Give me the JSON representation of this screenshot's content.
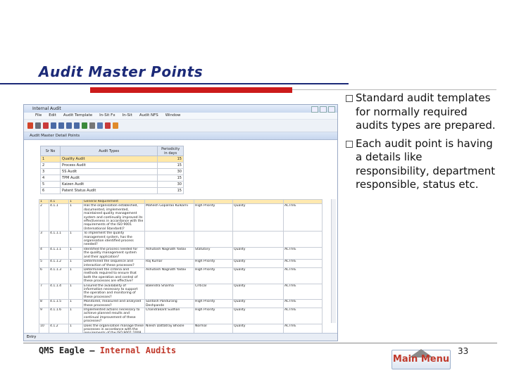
{
  "slide": {
    "title": "Audit Master Points",
    "bullets": [
      "Standard audit templates for normally required audits types are prepared.",
      "Each audit point is having a details like responsibility, department responsible, status etc."
    ],
    "footer_left_prefix": "QMS Eagle – ",
    "footer_left_accent": "Internal Audits",
    "main_menu_label": "Main Menu",
    "page_number": "33",
    "colors": {
      "title": "#1c2a78",
      "accent_red": "#cc1b1b",
      "footer_accent": "#c0392b"
    }
  },
  "app": {
    "window_title": "Internal Audit",
    "menu": [
      "File",
      "Edit",
      "Audit Template",
      "In-Sit Fx",
      "In-Sit",
      "Audit NFS",
      "Window"
    ],
    "subwindow_title": "Audit Master Detail Points",
    "types_headers": [
      "Sr No",
      "Audit Types",
      "Periodicity in days"
    ],
    "types_rows": [
      [
        "1",
        "Quality Audit",
        "15"
      ],
      [
        "2",
        "Process Audit",
        "15"
      ],
      [
        "3",
        "5S Audit",
        "30"
      ],
      [
        "4",
        "TPM Audit",
        "15"
      ],
      [
        "5",
        "Kaizen Audit",
        "30"
      ],
      [
        "6",
        "Patent Status Audit",
        "15"
      ]
    ],
    "points_rows": [
      [
        "1",
        "4.1",
        "1",
        "General Requirement",
        "",
        "",
        "",
        ""
      ],
      [
        "2",
        "4.1.1",
        "1",
        "Has the organisation established, documented, implemented, maintained quality management system and continually improved its effectiveness in accordance with the requirements of the ISO 9001 (International Standard)?",
        "Mahesh Gopalrao Kulkarni",
        "High Priority",
        "Quality",
        "ACTIVE"
      ],
      [
        "3",
        "4.1.1.1",
        "1",
        "To implement the quality management system, has the organisation identified process needed?",
        "",
        "",
        "",
        ""
      ],
      [
        "4",
        "4.1.1.1",
        "1",
        "Identified the process needed for the quality management system and their application?",
        "Ashutosh Nagnath Yadav",
        "Statutory",
        "Quality",
        "ACTIVE"
      ],
      [
        "5",
        "4.1.1.2",
        "1",
        "Determined the sequence and interaction of these processes?",
        "Raj Kumar",
        "High Priority",
        "Quality",
        "ACTIVE"
      ],
      [
        "6",
        "4.1.1.3",
        "1",
        "Determined the criteria and methods required to ensure that both the operation and control of these processes are effective?",
        "Ashutosh Nagnath Yadav",
        "High Priority",
        "Quality",
        "ACTIVE"
      ],
      [
        "7",
        "4.1.1.4",
        "1",
        "Ensured the availability of information necessary to support the operation and monitoring of these processes?",
        "Balendra Sharma",
        "Critical",
        "Quality",
        "ACTIVE"
      ],
      [
        "8",
        "4.1.1.5",
        "1",
        "Monitored, measured and analysed these processes?",
        "Santosh Pandurang Deshpande",
        "High Priority",
        "Quality",
        "ACTIVE"
      ],
      [
        "9",
        "4.1.1.6",
        "1",
        "Implemented actions necessary to achieve planned results and continual improvement of these processes?",
        "Chandrakant Sudhan",
        "High Priority",
        "Quality",
        "ACTIVE"
      ],
      [
        "10",
        "4.1.2",
        "1",
        "Does the organisation manage these processes in accordance with the requirements of the ISO 9001:2008 International Standard?",
        "Nilesh Dattatray Bhosle",
        "Normal",
        "Quality",
        "ACTIVE"
      ],
      [
        "11",
        "4.1.3",
        "1",
        "Are the processes that affect product conformity with requirements outsourced?",
        "Ashutosh Nagnath Yadav",
        "High Priority",
        "Quality",
        "ACTIVE"
      ]
    ],
    "status_tab": "Entry"
  }
}
